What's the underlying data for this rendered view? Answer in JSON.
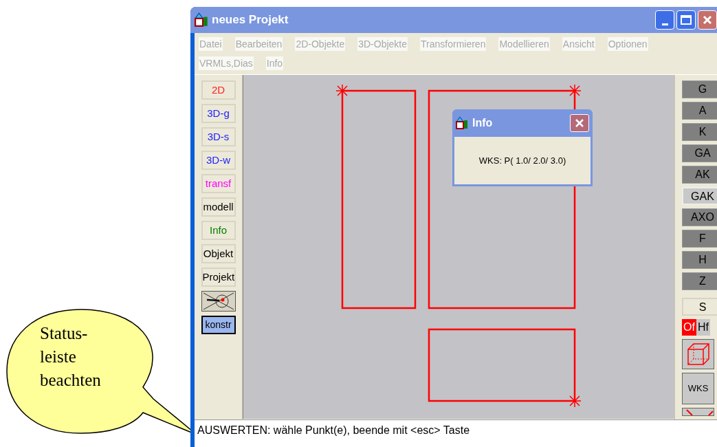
{
  "window": {
    "title": "neues Projekt"
  },
  "menu": [
    "Datei",
    "Bearbeiten",
    "2D-Objekte",
    "3D-Objekte",
    "Transformieren",
    "Modellieren",
    "Ansicht",
    "Optionen",
    "VRMLs,Dias",
    "Info"
  ],
  "left_toolbar": [
    {
      "kind": "text",
      "label": "2D",
      "color": "#ff2020",
      "selected": false
    },
    {
      "kind": "text",
      "label": "3D-g",
      "color": "#2020ff",
      "selected": false
    },
    {
      "kind": "text",
      "label": "3D-s",
      "color": "#2020ff",
      "selected": false
    },
    {
      "kind": "text",
      "label": "3D-w",
      "color": "#2020ff",
      "selected": false
    },
    {
      "kind": "text",
      "label": "transf",
      "color": "#ff00ff",
      "selected": false
    },
    {
      "kind": "text",
      "label": "modell",
      "color": "#000000",
      "selected": false
    },
    {
      "kind": "text",
      "label": "Info",
      "color": "#008000",
      "selected": false
    },
    {
      "kind": "text",
      "label": "Objekt",
      "color": "#000000",
      "selected": false
    },
    {
      "kind": "text",
      "label": "Projekt",
      "color": "#000000",
      "selected": false
    },
    {
      "kind": "icon",
      "selected": false
    },
    {
      "kind": "text",
      "label": "konstr",
      "color": "#000000",
      "selected": true
    }
  ],
  "right_toolbar": [
    {
      "label": "G",
      "selected": false
    },
    {
      "label": "A",
      "selected": false
    },
    {
      "label": "K",
      "selected": false
    },
    {
      "label": "GA",
      "selected": false
    },
    {
      "label": "AK",
      "selected": false
    },
    {
      "label": "GAK",
      "selected": true
    },
    {
      "label": "AXO",
      "selected": false
    },
    {
      "label": "F",
      "selected": false
    },
    {
      "label": "H",
      "selected": false
    },
    {
      "label": "Z",
      "selected": false
    }
  ],
  "s_button": {
    "label": "S"
  },
  "face_toggle": [
    {
      "label": "Of",
      "selected": true
    },
    {
      "label": "Hf",
      "selected": false
    }
  ],
  "wks_button": {
    "label": "WKS"
  },
  "info_dialog": {
    "title": "Info",
    "message": "WKS: P( 1.0/ 2.0/ 3.0)"
  },
  "status_bar": {
    "text": "AUSWERTEN: wähle Punkt(e), beende mit <esc> Taste"
  },
  "callout": {
    "lines": [
      "Status-",
      "leiste",
      "beachten"
    ]
  }
}
